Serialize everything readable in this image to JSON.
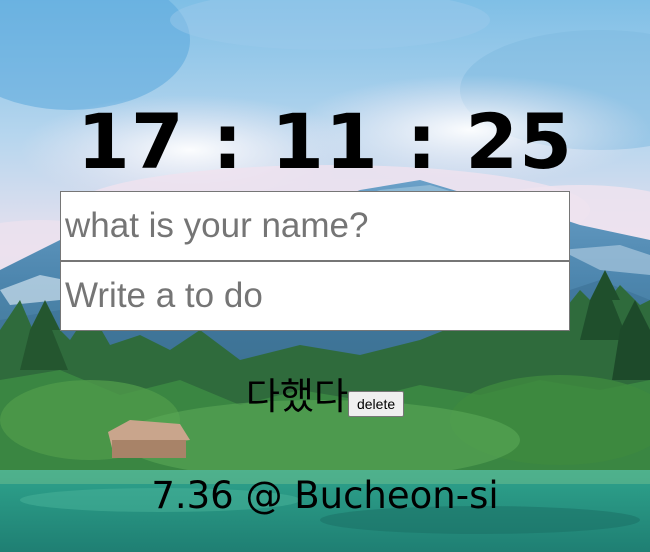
{
  "clock": {
    "time": "17 : 11 : 25"
  },
  "name_form": {
    "placeholder": "what is your name?",
    "value": ""
  },
  "todo_form": {
    "placeholder": "Write a to do",
    "value": ""
  },
  "todos": [
    {
      "text": "다했다",
      "delete_label": "delete"
    }
  ],
  "weather": {
    "text": "7.36 @ Bucheon-si"
  },
  "background": {
    "icon": "mountain-lake-landscape",
    "colors": {
      "sky": "#8fc3e4",
      "cloud": "#f1e6f0",
      "mountain": "#4f86ad",
      "forest": "#2f6a3a",
      "lake": "#2a9a86"
    }
  }
}
